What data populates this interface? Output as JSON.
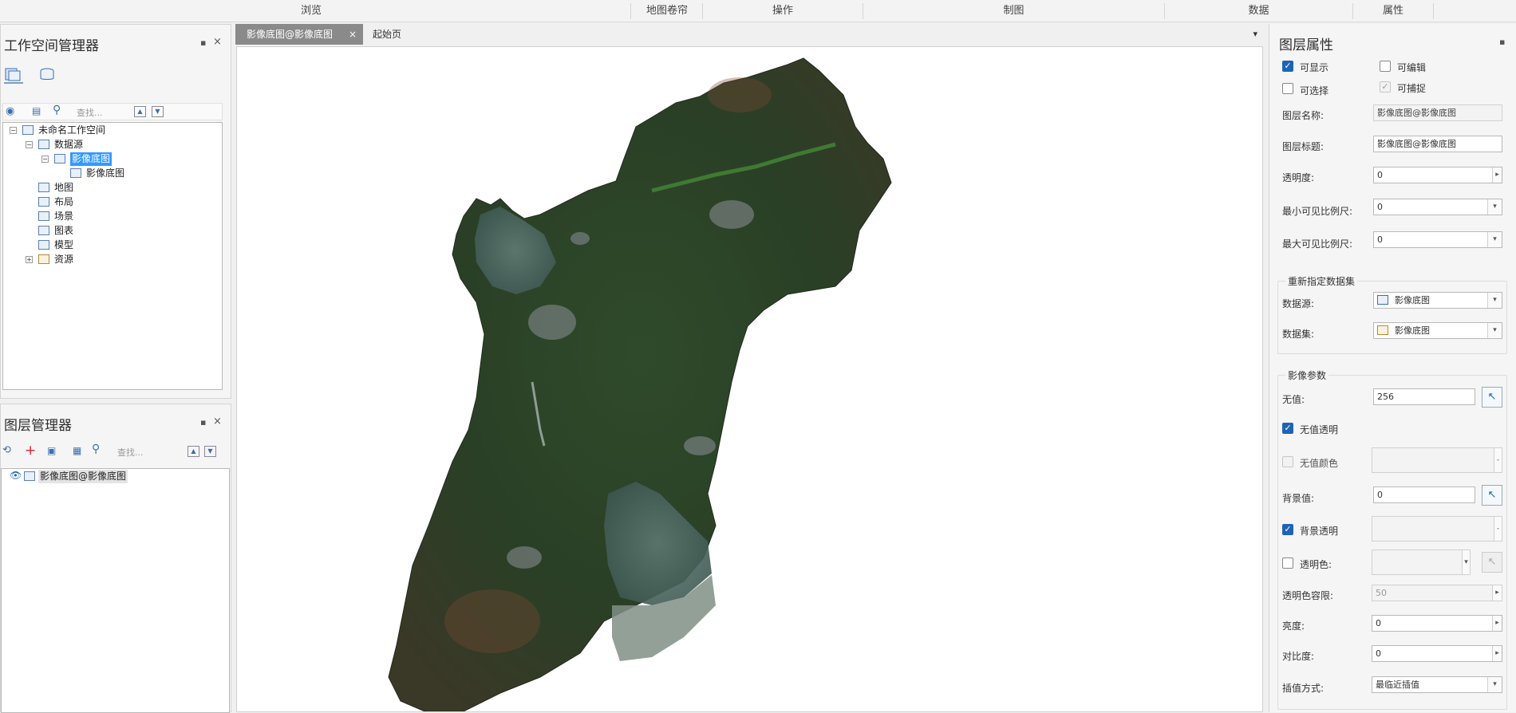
{
  "ribbon": {
    "browse": "浏览",
    "map_roll": "地图卷帘",
    "operate": "操作",
    "cartography": "制图",
    "data": "数据",
    "properties": "属性"
  },
  "workspace_panel": {
    "title": "工作空间管理器",
    "search_placeholder": "查找...",
    "tree": [
      {
        "label": "未命名工作空间"
      },
      {
        "label": "数据源"
      },
      {
        "label": "影像底图"
      },
      {
        "label": "影像底图"
      },
      {
        "label": "地图"
      },
      {
        "label": "布局"
      },
      {
        "label": "场景"
      },
      {
        "label": "图表"
      },
      {
        "label": "模型"
      },
      {
        "label": "资源"
      }
    ]
  },
  "layer_panel": {
    "title": "图层管理器",
    "search_placeholder": "查找...",
    "layers": [
      {
        "label": "影像底图@影像底图"
      }
    ]
  },
  "tabs": [
    {
      "label": "影像底图@影像底图",
      "close": "×"
    },
    {
      "label": "起始页"
    }
  ],
  "tab_menu_arrow": "▾",
  "properties": {
    "title": "图层属性",
    "visible": "可显示",
    "editable": "可编辑",
    "selectable": "可选择",
    "snappable": "可捕捉",
    "layer_name_label": "图层名称:",
    "layer_name": "影像底图@影像底图",
    "layer_caption_label": "图层标题:",
    "layer_caption": "影像底图@影像底图",
    "transparency_label": "透明度:",
    "transparency": "0",
    "min_scale_label": "最小可见比例尺:",
    "min_scale": "0",
    "max_scale_label": "最大可见比例尺:",
    "max_scale": "0",
    "reassign_group": "重新指定数据集",
    "datasource_label": "数据源:",
    "datasource": "影像底图",
    "dataset_label": "数据集:",
    "dataset": "影像底图",
    "image_group": "影像参数",
    "nodata_label": "无值:",
    "nodata": "256",
    "nodata_transparent": "无值透明",
    "nodata_color": "无值颜色",
    "background_label": "背景值:",
    "background": "0",
    "background_transparent": "背景透明",
    "transparent_color": "透明色:",
    "transparent_tolerance_label": "透明色容限:",
    "transparent_tolerance": "50",
    "brightness_label": "亮度:",
    "brightness": "0",
    "contrast_label": "对比度:",
    "contrast": "0",
    "interpolation_label": "插值方式:",
    "interpolation": "最临近插值"
  }
}
